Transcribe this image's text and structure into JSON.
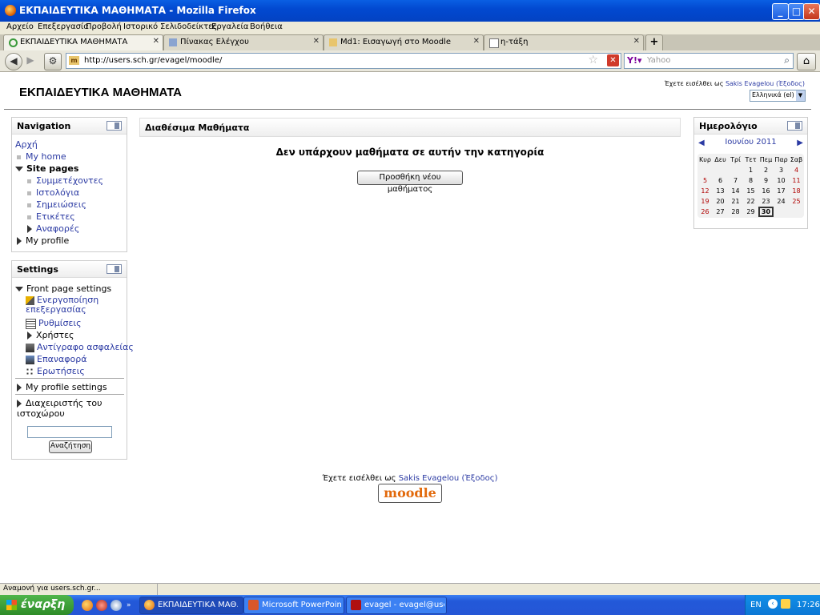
{
  "window": {
    "title": "ΕΚΠΑΙΔΕΥΤΙΚΑ ΜΑΘΗΜΑΤΑ - Mozilla Firefox"
  },
  "menu": [
    "Αρχείο",
    "Επεξεργασία",
    "Προβολή",
    "Ιστορικό",
    "Σελιδοδείκτες",
    "Εργαλεία",
    "Βοήθεια"
  ],
  "tabs": [
    {
      "label": "ΕΚΠΑΙΔΕΥΤΙΚΑ ΜΑΘΗΜΑΤΑ",
      "active": true
    },
    {
      "label": "Πίνακας Ελέγχου",
      "active": false
    },
    {
      "label": "Md1: Εισαγωγή στο Moodle",
      "active": false
    },
    {
      "label": "η-τάξη",
      "active": false
    }
  ],
  "navbar": {
    "url": "http://users.sch.gr/evagel/moodle/",
    "search_placeholder": "Yahoo"
  },
  "site": {
    "title": "ΕΚΠΑΙΔΕΥΤΙΚΑ ΜΑΘΗΜΑΤΑ",
    "login_prefix": "Έχετε εισέλθει ως",
    "user": "Sakis Evagelou",
    "logout": "(Έξοδος)",
    "language": "Ελληνικά (el)"
  },
  "navigation": {
    "title": "Navigation",
    "home": "Αρχή",
    "my_home": "My home",
    "site_pages": "Site pages",
    "site_items": [
      "Συμμετέχοντες",
      "Ιστολόγια",
      "Σημειώσεις",
      "Ετικέτες"
    ],
    "reports": "Αναφορές",
    "my_profile": "My profile"
  },
  "settings": {
    "title": "Settings",
    "front_page": "Front page settings",
    "items": {
      "edit_on": "Ενεργοποίηση επεξεργασίας",
      "config": "Ρυθμίσεις",
      "users": "Χρήστες",
      "backup": "Αντίγραφο ασφαλείας",
      "restore": "Επαναφορά",
      "questions": "Ερωτήσεις"
    },
    "my_profile_settings": "My profile settings",
    "site_admin": "Διαχειριστής του ιστοχώρου",
    "search_button": "Αναζήτηση"
  },
  "main": {
    "header": "Διαθέσιμα Μαθήματα",
    "message": "Δεν υπάρχουν μαθήματα σε αυτήν την κατηγορία",
    "add_button": "Προσθήκη νέου μαθήματος"
  },
  "calendar": {
    "title": "Ημερολόγιο",
    "month": "Ιουνίου 2011",
    "weekdays": [
      "Κυρ",
      "Δευ",
      "Τρί",
      "Τετ",
      "Πεμ",
      "Παρ",
      "Σαβ"
    ],
    "weeks": [
      [
        "",
        "",
        "",
        "1",
        "2",
        "3",
        "4"
      ],
      [
        "5",
        "6",
        "7",
        "8",
        "9",
        "10",
        "11"
      ],
      [
        "12",
        "13",
        "14",
        "15",
        "16",
        "17",
        "18"
      ],
      [
        "19",
        "20",
        "21",
        "22",
        "23",
        "24",
        "25"
      ],
      [
        "26",
        "27",
        "28",
        "29",
        "30",
        "",
        ""
      ]
    ],
    "today": "30",
    "weekend_color": "#b00000"
  },
  "footer": {
    "login_prefix": "Έχετε εισέλθει ως",
    "user": "Sakis Evagelou",
    "logout": "(Έξοδος)",
    "logo": "moodle"
  },
  "status": {
    "text": "Αναμονή για users.sch.gr..."
  },
  "taskbar": {
    "start": "έναρξη",
    "tasks": [
      {
        "label": "ΕΚΠΑΙΔΕΥΤΙΚΑ ΜΑΘ...",
        "active": true
      },
      {
        "label": "Microsoft PowerPoint ...",
        "active": false
      },
      {
        "label": "evagel - evagel@use...",
        "active": false
      }
    ],
    "lang": "EN",
    "clock": "17:26"
  }
}
